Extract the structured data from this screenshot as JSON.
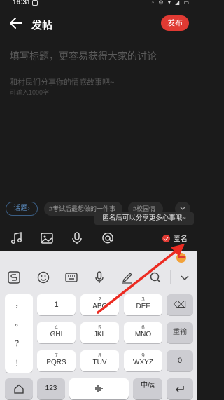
{
  "status_bar": {
    "time": "16:31",
    "indicators": "◔ ⚙ ▾ ◢ ▭"
  },
  "header": {
    "title": "发帖",
    "publish_label": "发布"
  },
  "compose": {
    "title_placeholder": "填写标题，更容易获得大家的讨论",
    "body_placeholder": "和村民们分享你的情感故事吧~",
    "limit_text": "可输入1000字"
  },
  "topic_row": {
    "topic_label": "话题",
    "topic_arrow": "›",
    "tags": [
      "#考试后最想做的一件事",
      "#校园情"
    ]
  },
  "tooltip": {
    "text": "匿名后可以分享更多心事哦~"
  },
  "toolbar": {
    "anonymous_label": "匿名"
  },
  "keyboard": {
    "punctuation": [
      "，",
      "。",
      "？",
      "！"
    ],
    "keys": [
      {
        "num": "1",
        "letters": ""
      },
      {
        "num": "2",
        "letters": "ABC"
      },
      {
        "num": "3",
        "letters": "DEF"
      },
      {
        "num": "4",
        "letters": "GHI"
      },
      {
        "num": "5",
        "letters": "JKL"
      },
      {
        "num": "6",
        "letters": "MNO"
      },
      {
        "num": "7",
        "letters": "PQRS"
      },
      {
        "num": "8",
        "letters": "TUV"
      },
      {
        "num": "9",
        "letters": "WXYZ"
      }
    ],
    "right_keys": [
      "⌫",
      "重输",
      "0"
    ],
    "bottom": {
      "num_label": "123",
      "lang_label": "中/",
      "lang_sub": "英"
    }
  },
  "colors": {
    "accent": "#e03a33",
    "background": "#1b1b1b",
    "keyboard_bg": "#e7e7ea"
  }
}
